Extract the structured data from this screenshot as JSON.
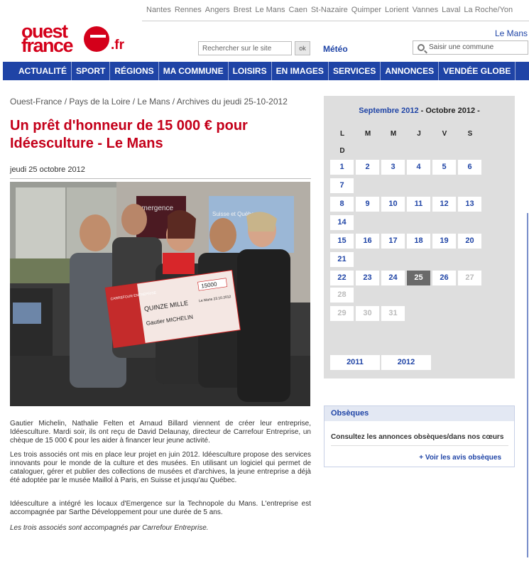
{
  "header": {
    "cities": [
      "Nantes",
      "Rennes",
      "Angers",
      "Brest",
      "Le Mans",
      "Caen",
      "St-Nazaire",
      "Quimper",
      "Lorient",
      "Vannes",
      "Laval",
      "La Roche/Yon"
    ],
    "logo_line1": "ouest",
    "logo_line2": "france",
    "logo_tld": ".fr",
    "current_city": "Le Mans",
    "search_placeholder": "Rechercher sur le site",
    "search_button": "ok",
    "meteo_label": "Météo",
    "commune_placeholder": "Saisir une commune"
  },
  "nav": [
    "ACTUALITÉ",
    "SPORT",
    "RÉGIONS",
    "MA COMMUNE",
    "LOISIRS",
    "EN IMAGES",
    "SERVICES",
    "ANNONCES",
    "VENDÉE GLOBE"
  ],
  "article": {
    "breadcrumb": "Ouest-France / Pays de la Loire / Le Mans / Archives du jeudi 25-10-2012",
    "title": "Un prêt d'honneur de 15 000 € pour Idéesculture - Le Mans",
    "date": "jeudi 25 octobre 2012",
    "paragraphs": [
      "Gautier Michelin, Nathalie Felten et Arnaud Billard viennent de créer leur entreprise, Idéesculture. Mardi soir, ils ont reçu de David Delaunay, directeur de Carrefour Entreprise, un chèque de 15 000 € pour les aider à financer leur jeune activité.",
      "Les trois associés ont mis en place leur projet en juin 2012. Idéesculture propose des services innovants pour le monde de la culture et des musées. En utilisant un logiciel qui permet de cataloguer, gérer et publier des collections de musées et d'archives, la jeune entreprise a déjà été adoptée par le musée Maillol à Paris, en Suisse et jusqu'au Québec.",
      "Idéesculture a intégré les locaux d'Emergence sur la Technopole du Mans. L'entreprise est accompagnée par Sarthe Développement pour une durée de 5 ans.",
      "Les trois associés sont accompagnés par Carrefour Entreprise."
    ],
    "photo": {
      "banner_text": "emergence",
      "screen_text": "Suisse et Québec",
      "cheque_org": "CARREFOUR ENTREPRISE",
      "cheque_amount": "15000",
      "cheque_words": "QUINZE MILLE",
      "cheque_place_date": "Le Mans 23.10.2012",
      "cheque_payee": "Gautier MICHELIN"
    }
  },
  "calendar": {
    "prev_month": "Septembre 2012",
    "current_month": "Octobre 2012",
    "sep1": " - ",
    "sep2": " -",
    "weekdays": [
      "L",
      "M",
      "M",
      "J",
      "V",
      "S",
      "D"
    ],
    "days": [
      {
        "n": "1"
      },
      {
        "n": "2"
      },
      {
        "n": "3"
      },
      {
        "n": "4"
      },
      {
        "n": "5"
      },
      {
        "n": "6"
      },
      {
        "n": "7"
      },
      {
        "n": "8"
      },
      {
        "n": "9"
      },
      {
        "n": "10"
      },
      {
        "n": "11"
      },
      {
        "n": "12"
      },
      {
        "n": "13"
      },
      {
        "n": "14"
      },
      {
        "n": "15"
      },
      {
        "n": "16"
      },
      {
        "n": "17"
      },
      {
        "n": "18"
      },
      {
        "n": "19"
      },
      {
        "n": "20"
      },
      {
        "n": "21"
      },
      {
        "n": "22"
      },
      {
        "n": "23"
      },
      {
        "n": "24"
      },
      {
        "n": "25",
        "today": true
      },
      {
        "n": "26"
      },
      {
        "n": "27",
        "disabled": true
      },
      {
        "n": "28",
        "disabled": true
      },
      {
        "n": "29",
        "disabled": true
      },
      {
        "n": "30",
        "disabled": true
      },
      {
        "n": "31",
        "disabled": true
      }
    ],
    "years": [
      "2011",
      "2012"
    ]
  },
  "obseques": {
    "title": "Obsèques",
    "text": "Consultez les annonces obsèques/dans nos cœurs",
    "link": "+ Voir les avis obsèques"
  }
}
